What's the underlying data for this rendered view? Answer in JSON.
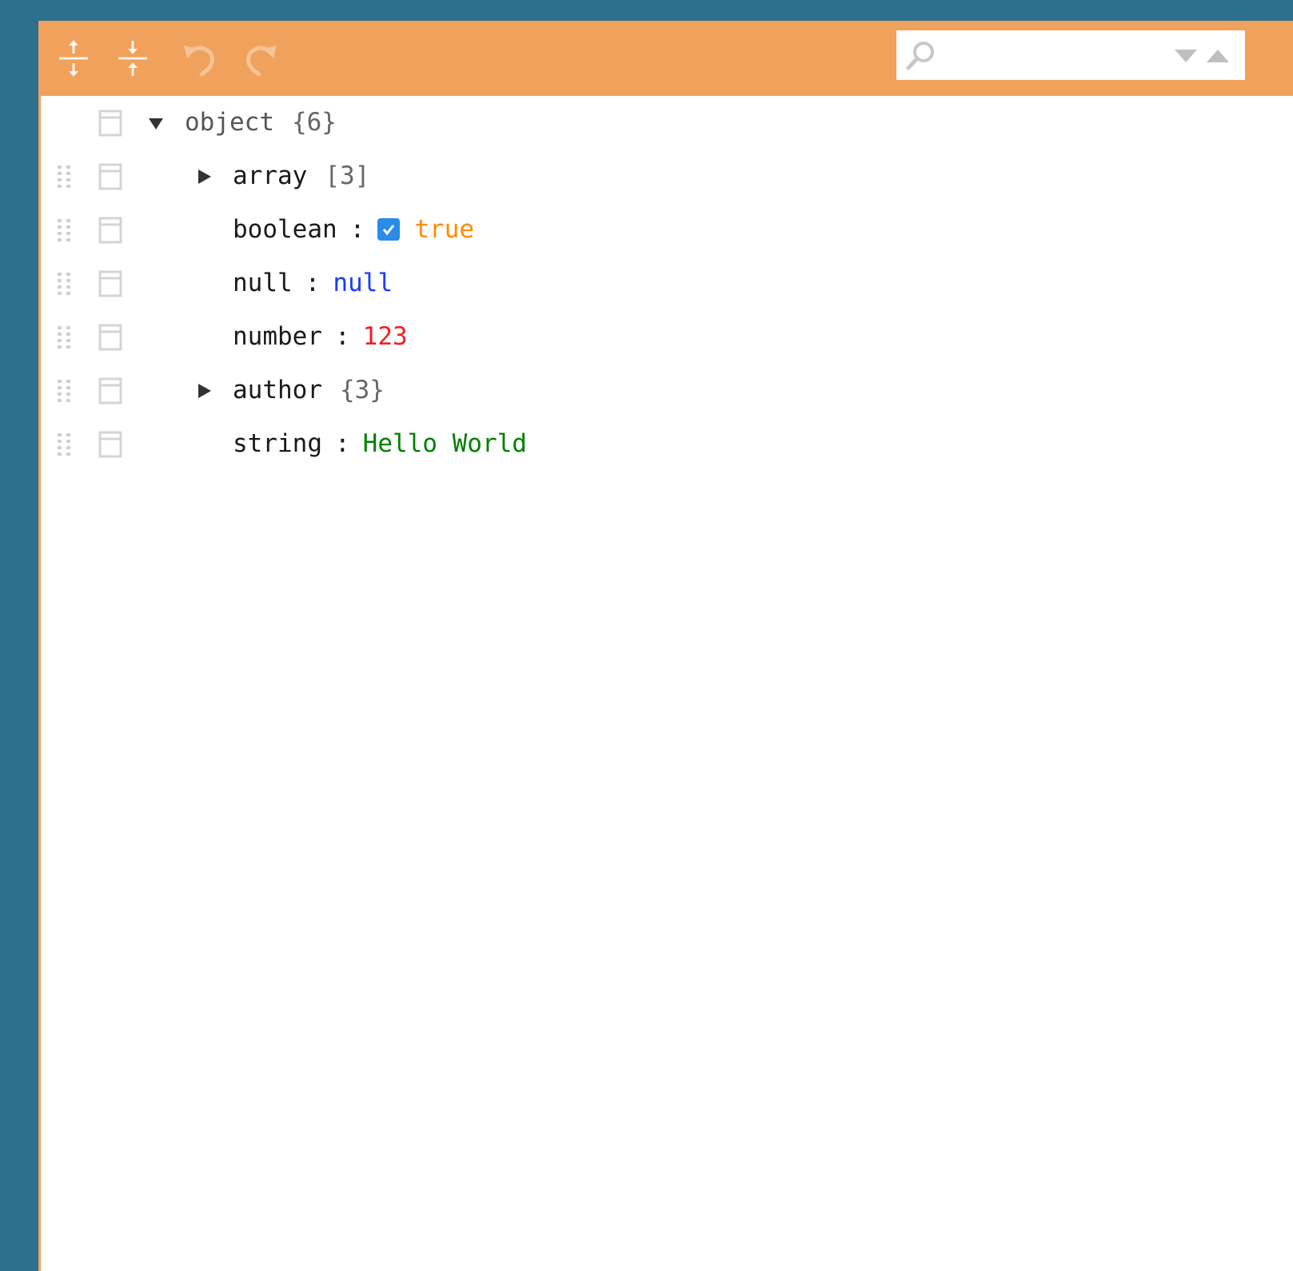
{
  "colors": {
    "background": "#2e6f8e",
    "toolbar": "#f0a15b",
    "boolean": "#ff8c00",
    "null": "#1a3cff",
    "number": "#ee2222",
    "string": "#008000"
  },
  "toolbar": {
    "icons": [
      "expand-all-icon",
      "collapse-all-icon",
      "undo-icon",
      "redo-icon"
    ],
    "search": {
      "placeholder": "",
      "value": ""
    }
  },
  "tree": {
    "root": {
      "key": "object",
      "count": "{6}",
      "expanded": true
    },
    "children": [
      {
        "key": "array",
        "type": "array",
        "count": "[3]",
        "expanded": false
      },
      {
        "key": "boolean",
        "type": "boolean",
        "separator": ":",
        "value": "true",
        "checked": true
      },
      {
        "key": "null",
        "type": "null",
        "separator": ":",
        "value": "null"
      },
      {
        "key": "number",
        "type": "number",
        "separator": ":",
        "value": "123"
      },
      {
        "key": "author",
        "type": "object",
        "count": "{3}",
        "expanded": false
      },
      {
        "key": "string",
        "type": "string",
        "separator": ":",
        "value": "Hello World"
      }
    ]
  }
}
